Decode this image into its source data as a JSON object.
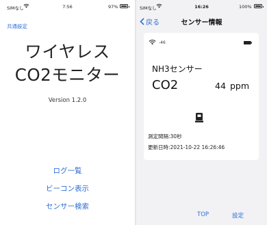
{
  "left_screen": {
    "status": {
      "carrier": "SIMなし",
      "time": "7:56",
      "battery_pct": "97%",
      "battery_level": 0.97
    },
    "settings_link": "共通設定",
    "app_title_line1": "ワイヤレス",
    "app_title_line2": "CO2モニター",
    "version": "Version 1.2.0",
    "menu": [
      {
        "label": "ログ一覧"
      },
      {
        "label": "ビーコン表示"
      },
      {
        "label": "センサー検索"
      }
    ]
  },
  "right_screen": {
    "status": {
      "carrier": "SIMなし",
      "time": "16:26",
      "battery_pct": "100%",
      "battery_level": 1.0
    },
    "nav": {
      "back_label": "戻る",
      "title": "センサー情報"
    },
    "card": {
      "rssi": "-46",
      "sensor_name": "NH3センサー",
      "gas": "CO2",
      "value": "44",
      "unit": "ppm",
      "interval": "測定間隔:30秒",
      "updated": "更新日時:2021-10-22 16:26:46"
    },
    "bottom_buttons": [
      {
        "label": "TOP"
      },
      {
        "label": "設定"
      }
    ]
  },
  "colors": {
    "accent_blue": "#2f6fd6",
    "panel_bg": "#f2f2f4",
    "card_bg": "#ffffff"
  },
  "icons": [
    "wifi-icon",
    "battery-icon",
    "chevron-left-icon",
    "signal-icon",
    "device-battery-icon"
  ]
}
